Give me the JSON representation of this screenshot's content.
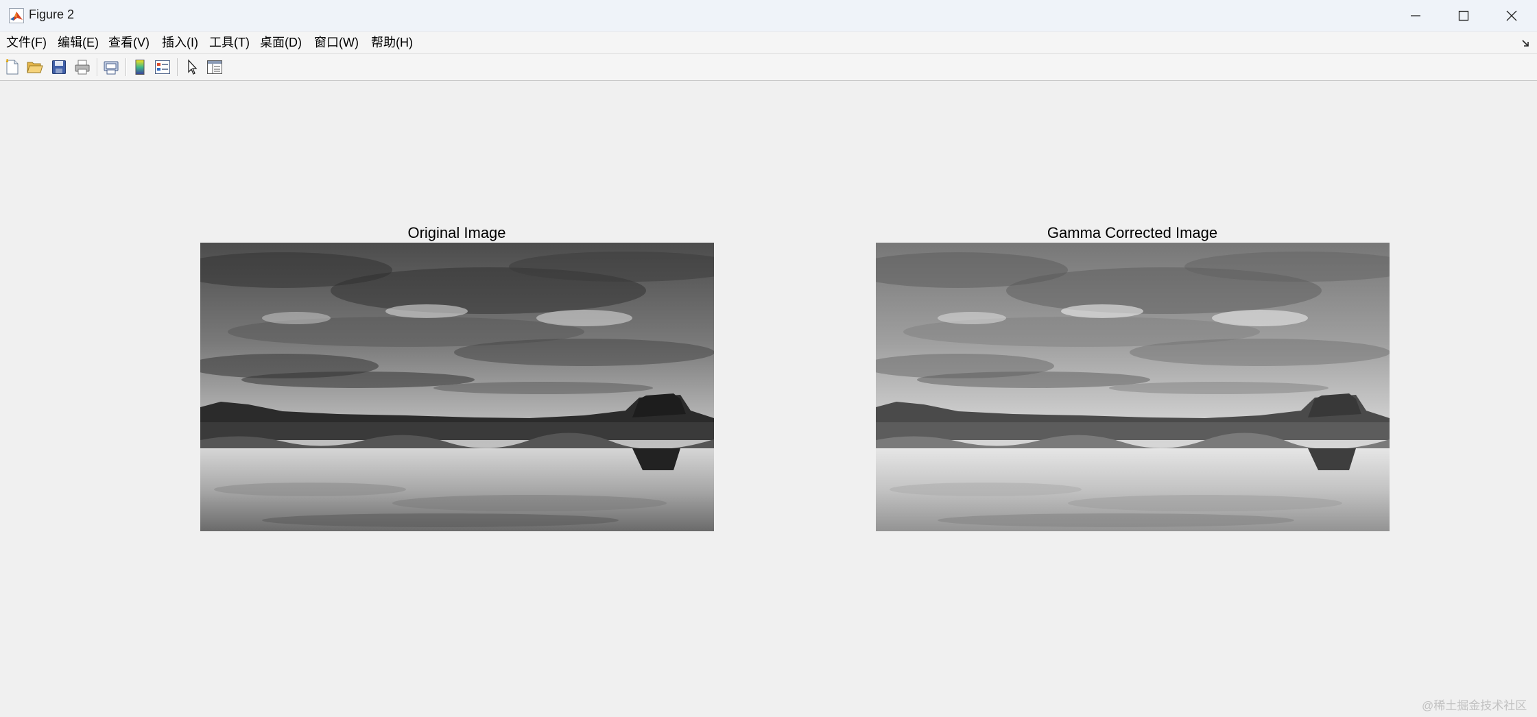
{
  "window": {
    "title": "Figure 2",
    "controls": [
      "minimize-icon",
      "maximize-icon",
      "close-icon"
    ]
  },
  "menu": [
    {
      "label": "文件(F)"
    },
    {
      "label": "编辑(E)"
    },
    {
      "label": "查看(V)"
    },
    {
      "label": "插入(I)"
    },
    {
      "label": "工具(T)"
    },
    {
      "label": "桌面(D)"
    },
    {
      "label": "窗口(W)"
    },
    {
      "label": "帮助(H)"
    }
  ],
  "toolbar": {
    "icons": [
      "new-figure-icon",
      "open-file-icon",
      "save-icon",
      "print-icon",
      "print-preview-icon",
      "colorbar-icon",
      "legend-icon",
      "edit-plot-icon",
      "property-inspector-icon"
    ]
  },
  "figure": {
    "axes": [
      {
        "title": "Original Image"
      },
      {
        "title": "Gamma Corrected Image"
      }
    ]
  },
  "watermark": "@稀土掘金技术社区",
  "colors": {
    "titlebar": "#eff3f9",
    "figure_background": "#f0f0f0",
    "menubar": "#f5f5f5"
  }
}
